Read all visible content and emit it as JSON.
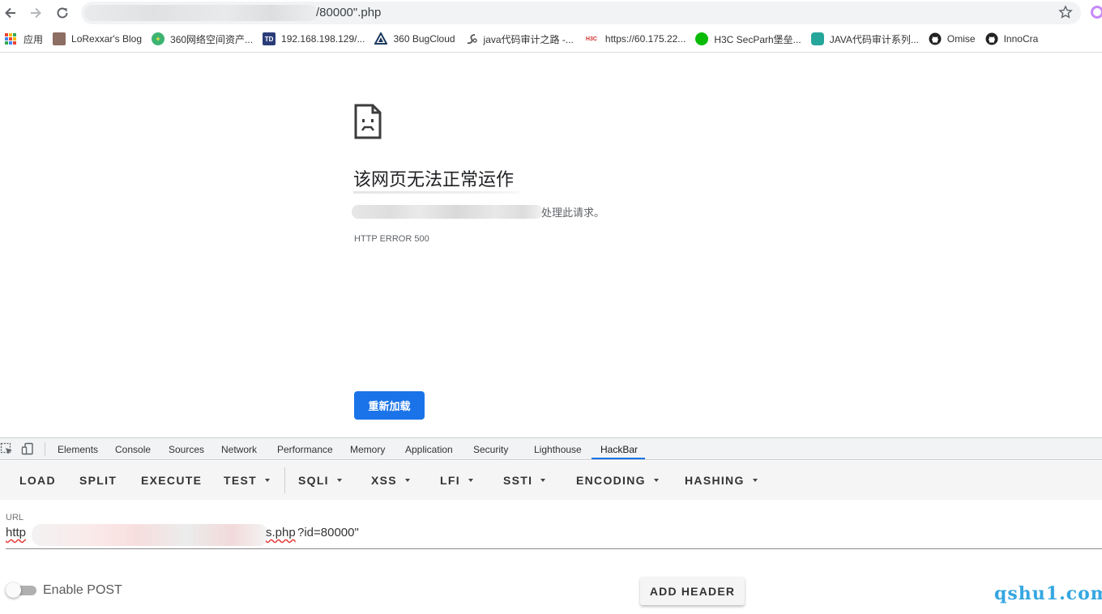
{
  "browser": {
    "address_text": "/80000\".php",
    "bookmarks": [
      {
        "label": "应用",
        "icon": "apps-grid-icon"
      },
      {
        "label": "LoRexxar's Blog",
        "icon": "blog-icon"
      },
      {
        "label": "360网络空间资产...",
        "icon": "360-icon"
      },
      {
        "label": "192.168.198.129/...",
        "icon": "td-icon"
      },
      {
        "label": "360 BugCloud",
        "icon": "bugcloud-icon"
      },
      {
        "label": "java代码审计之路 -...",
        "icon": "java-icon"
      },
      {
        "label": "https://60.175.22...",
        "icon": "h3c-icon"
      },
      {
        "label": "H3C SecParh堡垒...",
        "icon": "wechat-icon"
      },
      {
        "label": "JAVA代码审计系列...",
        "icon": "shield-icon"
      },
      {
        "label": "Omise",
        "icon": "github-icon"
      },
      {
        "label": "InnoCra",
        "icon": "github-icon"
      }
    ],
    "bookmark_h3c_badge": "H3C",
    "bookmark_td_badge": "TD"
  },
  "error_page": {
    "title": "该网页无法正常运作",
    "description": "处理此请求。",
    "code": "HTTP ERROR 500",
    "reload_label": "重新加载"
  },
  "devtools": {
    "tabs": [
      "Elements",
      "Console",
      "Sources",
      "Network",
      "Performance",
      "Memory",
      "Application",
      "Security",
      "Lighthouse",
      "HackBar"
    ],
    "active_tab": "HackBar"
  },
  "hackbar": {
    "buttons": [
      {
        "label": "LOAD",
        "dropdown": false
      },
      {
        "label": "SPLIT",
        "dropdown": false
      },
      {
        "label": "EXECUTE",
        "dropdown": false
      },
      {
        "label": "TEST",
        "dropdown": true
      },
      {
        "label": "SQLI",
        "dropdown": true
      },
      {
        "label": "XSS",
        "dropdown": true
      },
      {
        "label": "LFI",
        "dropdown": true
      },
      {
        "label": "SSTI",
        "dropdown": true
      },
      {
        "label": "ENCODING",
        "dropdown": true
      },
      {
        "label": "HASHING",
        "dropdown": true
      }
    ],
    "url_label": "URL",
    "url_prefix": "http",
    "url_suffix_a": "s.php",
    "url_suffix_b": "?id=80000\"",
    "enable_post_label": "Enable POST",
    "enable_post": false,
    "add_header_label": "ADD HEADER"
  },
  "watermark": "qshu1.com",
  "colors": {
    "accent": "#1a73e8",
    "watermark": "#35a7e0",
    "spell_underline": "#e53935"
  }
}
